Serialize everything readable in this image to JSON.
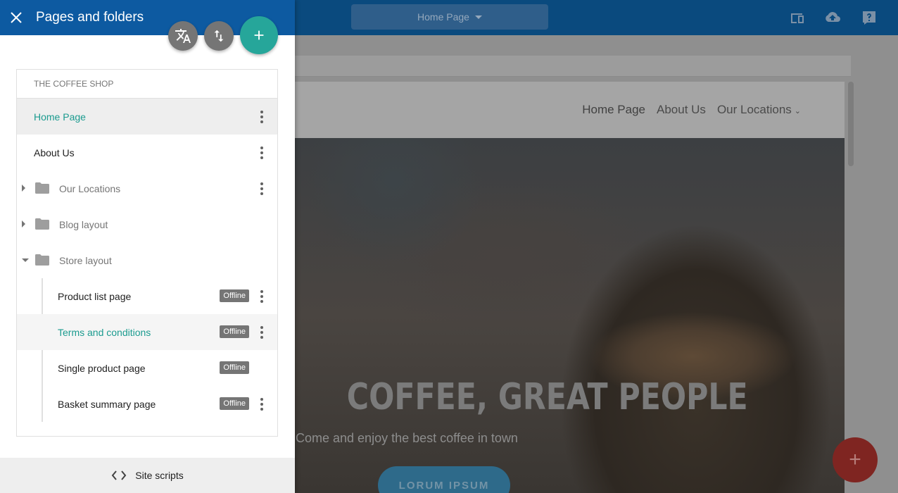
{
  "drawer": {
    "title": "Pages and folders",
    "site_name": "THE COFFEE SHOP",
    "footer_label": "Site scripts",
    "offline_label": "Offline",
    "items": [
      {
        "label": "Home Page",
        "type": "page",
        "state": "selected"
      },
      {
        "label": "About Us",
        "type": "page"
      },
      {
        "label": "Our Locations",
        "type": "folder",
        "expanded": false
      },
      {
        "label": "Blog layout",
        "type": "folder",
        "expanded": false
      },
      {
        "label": "Store layout",
        "type": "folder",
        "expanded": true,
        "children": [
          {
            "label": "Product list page",
            "status": "Offline"
          },
          {
            "label": "Terms and conditions",
            "status": "Offline",
            "state": "hover"
          },
          {
            "label": "Single product page",
            "status": "Offline"
          },
          {
            "label": "Basket summary page",
            "status": "Offline"
          }
        ]
      }
    ]
  },
  "topbar": {
    "page_select": "Home Page"
  },
  "site": {
    "nav": [
      "Home Page",
      "About Us",
      "Our Locations"
    ],
    "hero_title": "COFFEE, GREAT PEOPLE",
    "hero_subtitle": "Come and enjoy the best coffee in town",
    "hero_cta": "LORUM IPSUM"
  },
  "colors": {
    "header_blue": "#0d5aa1",
    "accent_teal": "#26a69a",
    "fab_grey": "#757575"
  }
}
